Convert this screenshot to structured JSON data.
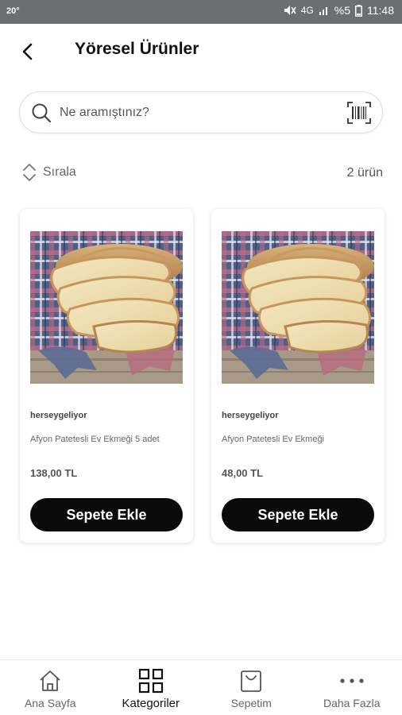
{
  "status_bar": {
    "temperature": "20°",
    "network": "4G",
    "battery_percent": "%5",
    "time": "11:48",
    "icons": [
      "mute-icon",
      "signal-icon",
      "battery-icon"
    ]
  },
  "header": {
    "title": "Yöresel Ürünler",
    "back_icon": "chevron-left-icon"
  },
  "search": {
    "placeholder": "Ne aramıştınız?",
    "value": "",
    "icons": [
      "search-icon",
      "barcode-icon"
    ]
  },
  "toolbar": {
    "sort_label": "Sırala",
    "count_label": "2 ürün"
  },
  "products": [
    {
      "seller": "herseygeliyor",
      "name": "Afyon Patetesli Ev Ekmeği 5 adet",
      "price": "138,00 TL",
      "button": "Sepete Ekle"
    },
    {
      "seller": "herseygeliyor",
      "name": "Afyon Patetesli Ev Ekmeği",
      "price": "48,00 TL",
      "button": "Sepete Ekle"
    }
  ],
  "bottom_nav": [
    {
      "label": "Ana Sayfa",
      "icon": "home-icon",
      "active": false
    },
    {
      "label": "Kategoriler",
      "icon": "grid-icon",
      "active": true
    },
    {
      "label": "Sepetim",
      "icon": "shopping-bag-icon",
      "active": false
    },
    {
      "label": "Daha Fazla",
      "icon": "more-dots-icon",
      "active": false
    }
  ],
  "colors": {
    "status_bar": "#6b6f73",
    "button_bg": "#0a0a0a",
    "button_text": "#ffffff",
    "text_primary": "#111111",
    "text_secondary": "#666666"
  }
}
